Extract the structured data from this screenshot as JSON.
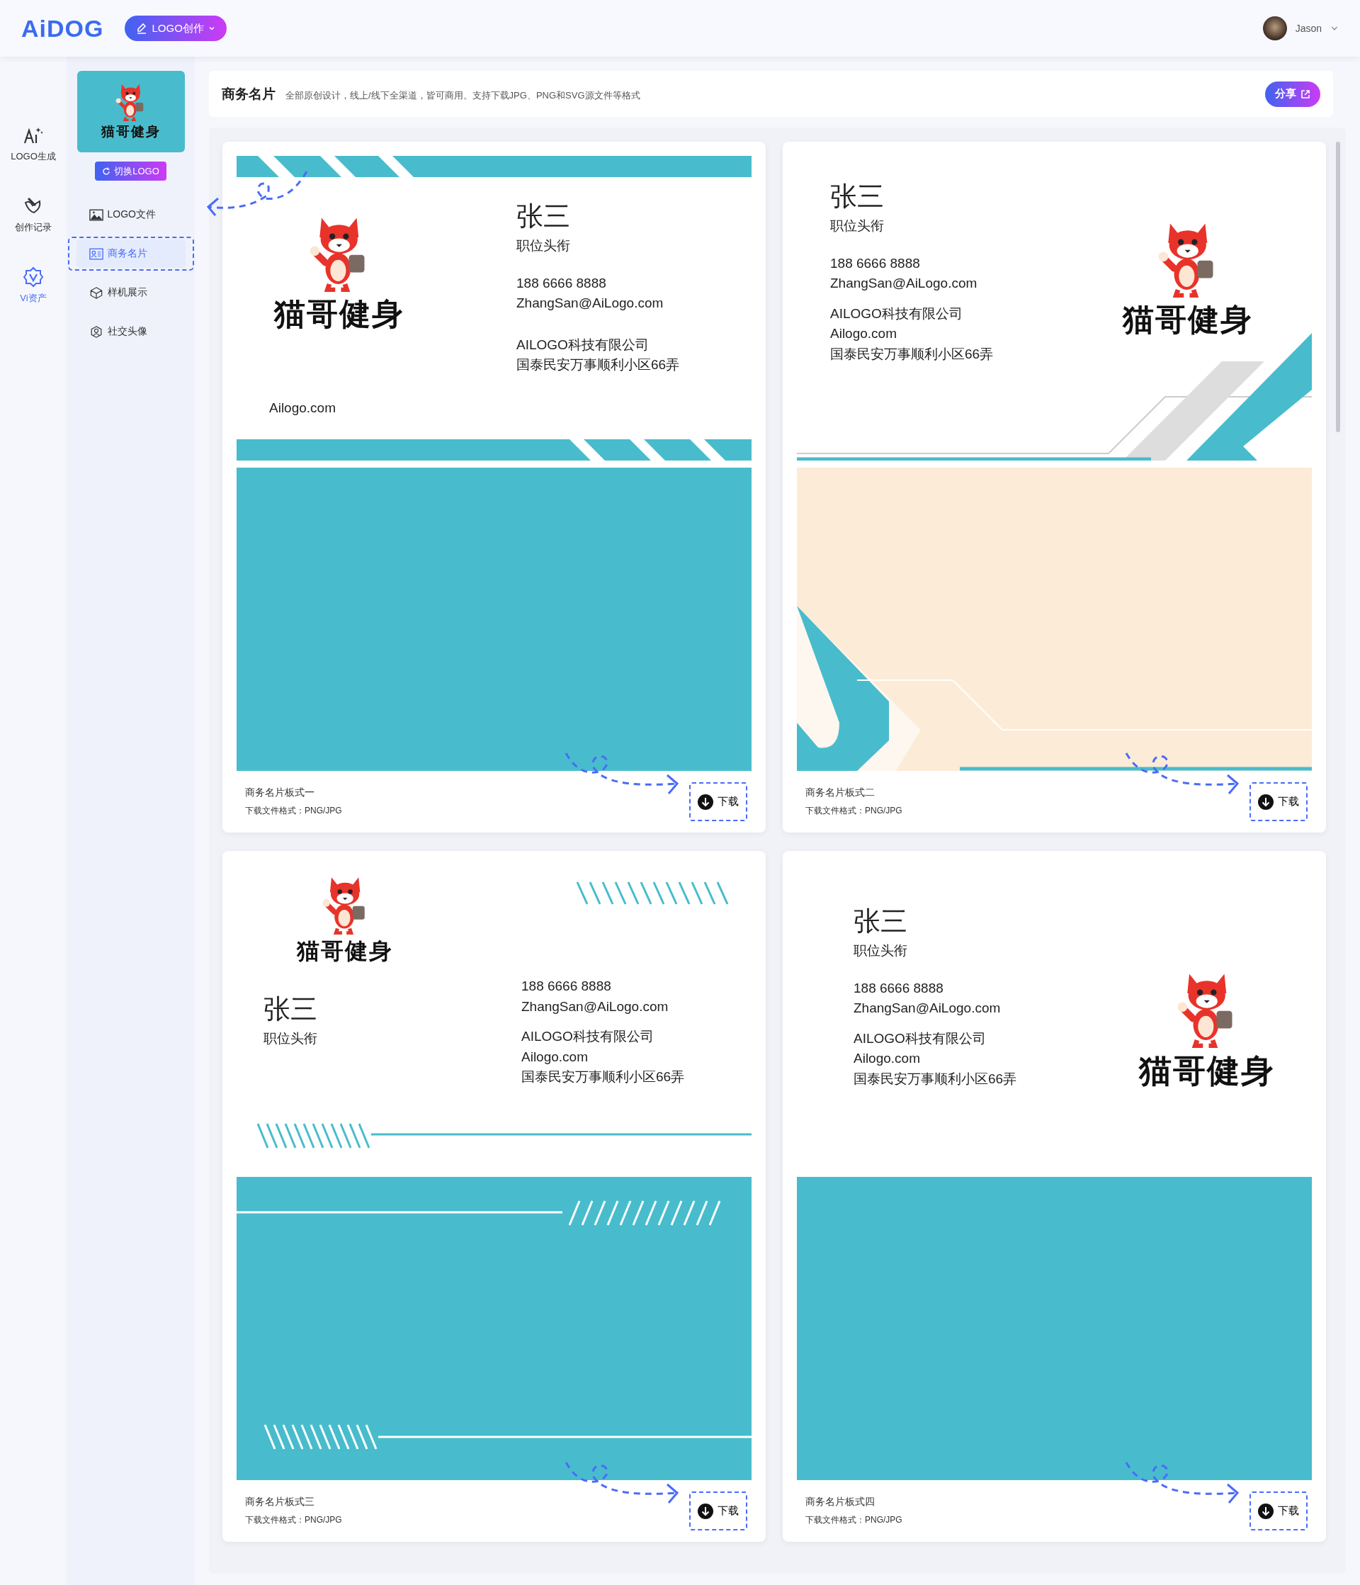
{
  "header": {
    "brand": "AiDOG",
    "create_button": "LOGO创作",
    "user": {
      "name": "Jason"
    }
  },
  "rail": [
    {
      "label": "LOGO生成",
      "kind": "ai",
      "selected": false
    },
    {
      "label": "创作记录",
      "kind": "brush",
      "selected": false
    },
    {
      "label": "Vi资产",
      "kind": "vi",
      "selected": true
    }
  ],
  "sidebar": {
    "logo_text": "猫哥健身",
    "switch_button": "切换LOGO",
    "items": [
      {
        "label": "LOGO文件",
        "kind": "image",
        "selected": false
      },
      {
        "label": "商务名片",
        "kind": "card",
        "selected": true
      },
      {
        "label": "样机展示",
        "kind": "cube",
        "selected": false
      },
      {
        "label": "社交头像",
        "kind": "avatar",
        "selected": false
      }
    ]
  },
  "page": {
    "title": "商务名片",
    "subtitle": "全部原创设计，线上/线下全渠道，皆可商用。支持下载JPG、PNG和SVG源文件等格式",
    "share_button": "分享"
  },
  "cards": [
    {
      "kind": "style1",
      "logo_text": "猫哥健身",
      "name": "张三",
      "job_title": "职位头衔",
      "phone": "188 6666 8888",
      "email": "ZhangSan@AiLogo.com",
      "company": "AILOGO科技有限公司",
      "website": "Ailogo.com",
      "address": "国泰民安万事顺利小区66弄",
      "caption": "商务名片板式一",
      "format": "下载文件格式：PNG/JPG",
      "download_button": "下载"
    },
    {
      "kind": "style2",
      "logo_text": "猫哥健身",
      "name": "张三",
      "job_title": "职位头衔",
      "phone": "188 6666 8888",
      "email": "ZhangSan@AiLogo.com",
      "company": "AILOGO科技有限公司",
      "website": "Ailogo.com",
      "address": "国泰民安万事顺利小区66弄",
      "caption": "商务名片板式二",
      "format": "下载文件格式：PNG/JPG",
      "download_button": "下载"
    },
    {
      "kind": "style3",
      "logo_text": "猫哥健身",
      "name": "张三",
      "job_title": "职位头衔",
      "phone": "188 6666 8888",
      "email": "ZhangSan@AiLogo.com",
      "company": "AILOGO科技有限公司",
      "website": "Ailogo.com",
      "address": "国泰民安万事顺利小区66弄",
      "caption": "商务名片板式三",
      "format": "下载文件格式：PNG/JPG",
      "download_button": "下载"
    },
    {
      "kind": "style4",
      "logo_text": "猫哥健身",
      "name": "张三",
      "job_title": "职位头衔",
      "phone": "188 6666 8888",
      "email": "ZhangSan@AiLogo.com",
      "company": "AILOGO科技有限公司",
      "website": "Ailogo.com",
      "address": "国泰民安万事顺利小区66弄",
      "caption": "商务名片板式四",
      "format": "下载文件格式：PNG/JPG",
      "download_button": "下载"
    }
  ]
}
